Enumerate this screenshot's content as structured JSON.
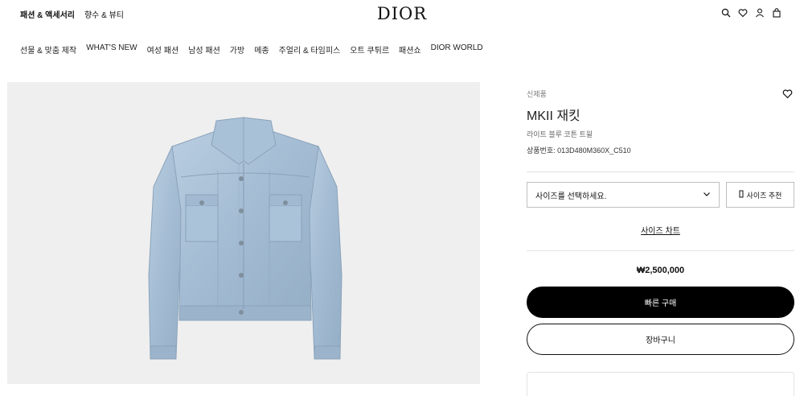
{
  "header": {
    "left_links": [
      "패션 & 액세서리",
      "향수 & 뷰티"
    ],
    "logo": "DIOR",
    "icons": [
      "search-icon",
      "heart-icon",
      "user-icon",
      "bag-icon"
    ]
  },
  "nav": {
    "items": [
      "선물 & 맞춤 제작",
      "WHAT'S NEW",
      "여성 패션",
      "남성 패션",
      "가방",
      "메종",
      "주얼리 & 타임피스",
      "오트 쿠튀르",
      "패션쇼",
      "DIOR WORLD"
    ]
  },
  "product": {
    "badge": "신제품",
    "title": "MKII 재킷",
    "subtitle": "라이트 블루 코튼 트윌",
    "sku": "상품번호: 013D480M360X_C510",
    "size_placeholder": "사이즈를 선택하세요.",
    "size_reco_label": "사이즈 추천",
    "size_chart_label": "사이즈 차트",
    "price": "₩2,500,000",
    "buy_now_label": "빠른 구매",
    "add_to_cart_label": "장바구니"
  },
  "colors": {
    "denim": "#a9c1d6",
    "image_bg": "#efefef",
    "primary_button": "#000000"
  }
}
